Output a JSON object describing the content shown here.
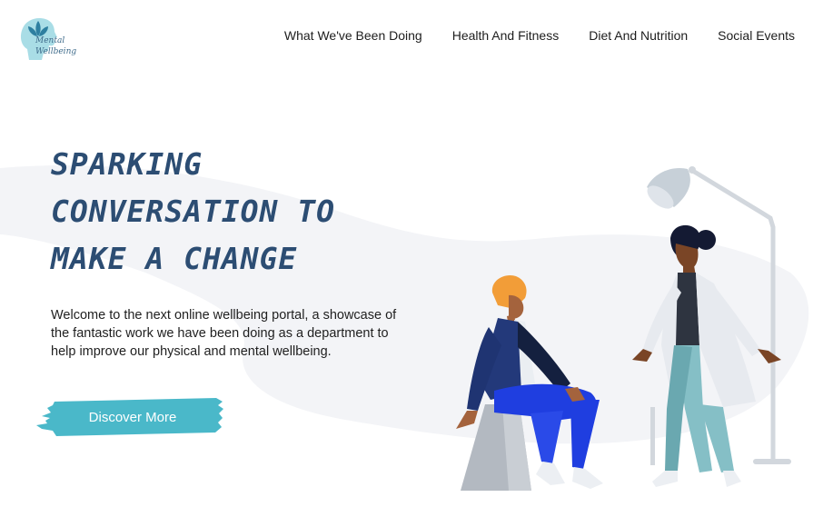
{
  "header": {
    "logo": {
      "line1": "Mental",
      "line2": "Wellbeing"
    },
    "nav": [
      {
        "label": "What We've Been Doing"
      },
      {
        "label": "Health And Fitness"
      },
      {
        "label": "Diet And Nutrition"
      },
      {
        "label": "Social Events"
      }
    ]
  },
  "hero": {
    "title_lines": [
      "Sparking",
      "conversation to",
      "make a change"
    ],
    "description": "Welcome to the next online wellbeing portal, a showcase of the fantastic work we have been doing as a department to help improve our physical and mental wellbeing.",
    "cta_label": "Discover More"
  },
  "colors": {
    "title": "#2c4d73",
    "cta": "#4ab8c9",
    "blob": "#f3f4f7",
    "logo": "#4ab8c9"
  },
  "icons": [
    "logo-head-icon",
    "lotus-icon",
    "floor-lamp-icon"
  ]
}
